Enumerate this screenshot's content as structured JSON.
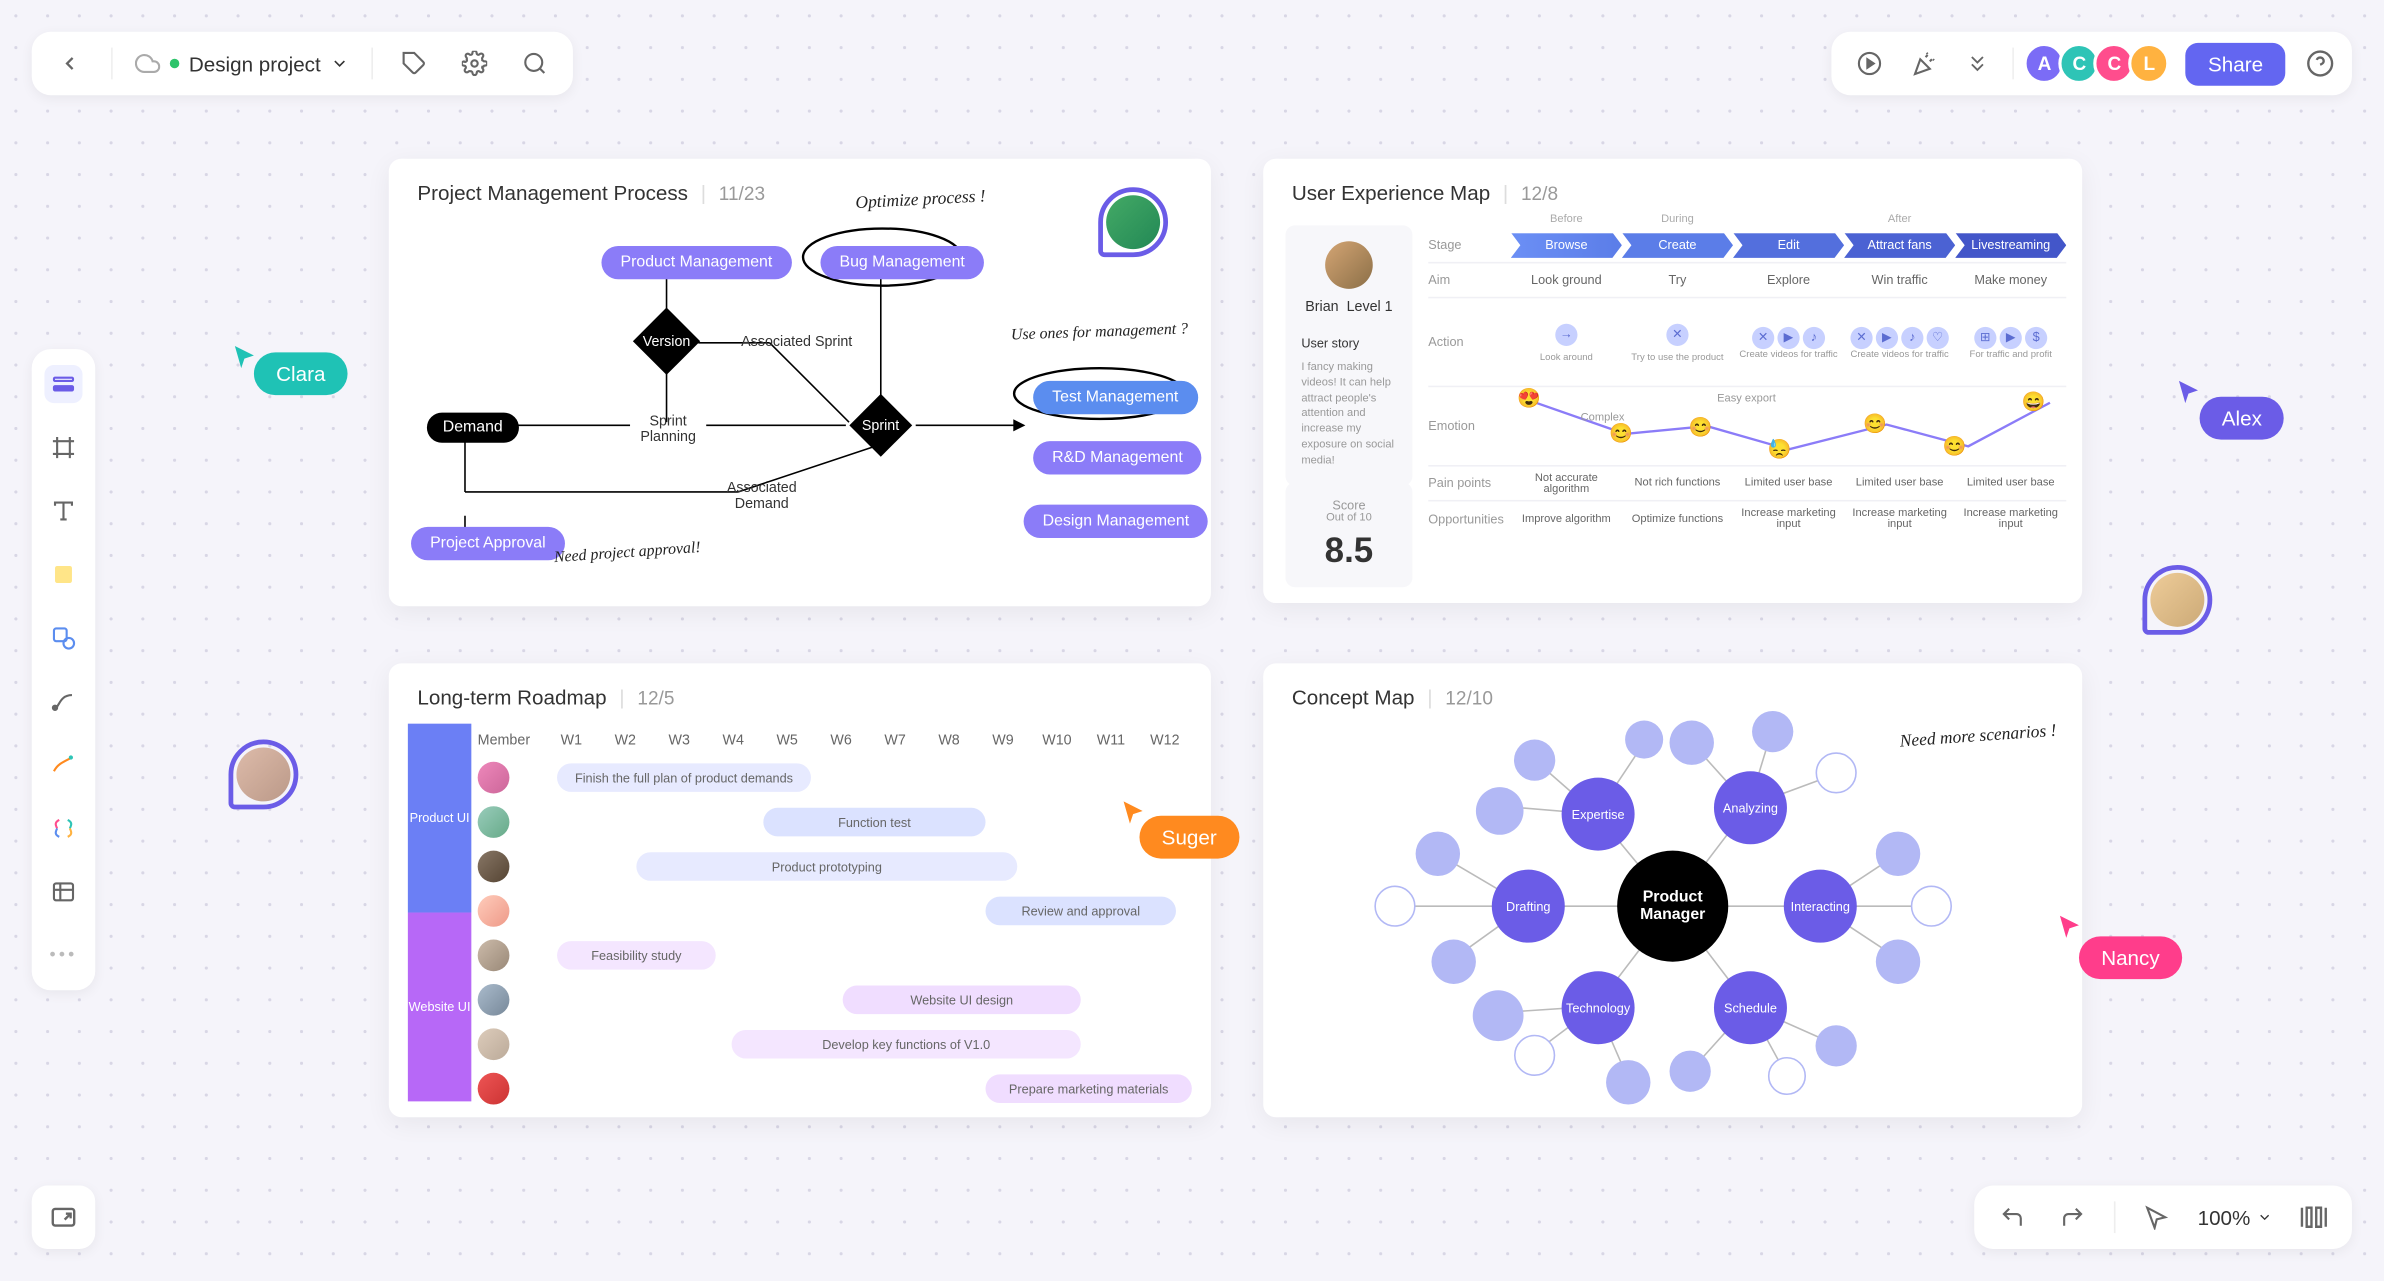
{
  "project": {
    "name": "Design project"
  },
  "topbar": {
    "share_label": "Share",
    "collaborators": [
      {
        "initial": "A",
        "color": "#7b6cf6"
      },
      {
        "initial": "C",
        "color": "#2ec4b6"
      },
      {
        "initial": "C",
        "color": "#ff4d8d"
      },
      {
        "initial": "L",
        "color": "#ffb240"
      }
    ]
  },
  "zoom": {
    "level": "100%"
  },
  "cursors": {
    "clara": {
      "label": "Clara",
      "color": "#1fc2b5"
    },
    "alex": {
      "label": "Alex",
      "color": "#6b5ce7"
    },
    "suger": {
      "label": "Suger",
      "color": "#ff8a1f"
    },
    "nancy": {
      "label": "Nancy",
      "color": "#ff3d8b"
    }
  },
  "card_process": {
    "title": "Project Management Process",
    "date": "11/23",
    "nodes": {
      "product_mgmt": "Product Management",
      "bug_mgmt": "Bug Management",
      "version": "Version",
      "demand": "Demand",
      "sprint": "Sprint",
      "test_mgmt": "Test Management",
      "rd_mgmt": "R&D Management",
      "design_mgmt": "Design Management",
      "project_approval": "Project Approval"
    },
    "labels": {
      "assoc_sprint": "Associated Sprint",
      "sprint_planning": "Sprint Planning",
      "assoc_demand": "Associated Demand"
    },
    "notes": {
      "optimize": "Optimize process !",
      "use_ones": "Use ones for management ?",
      "need_approval": "Need project approval!"
    }
  },
  "card_ux": {
    "title": "User Experience Map",
    "date": "12/8",
    "persona": {
      "name": "Brian",
      "level": "Level 1"
    },
    "user_story_label": "User story",
    "user_story": "I fancy making videos! It can help attract people's attention and increase my exposure on social media!",
    "score_label": "Score",
    "score_sub": "Out of 10",
    "score_value": "8.5",
    "phases_top": [
      "Before",
      "During",
      "After"
    ],
    "rows": {
      "stage": "Stage",
      "aim": "Aim",
      "action": "Action",
      "emotion": "Emotion",
      "pain": "Pain points",
      "opp": "Opportunities"
    },
    "stages": [
      "Browse",
      "Create",
      "Edit",
      "Attract fans",
      "Livestreaming"
    ],
    "aims": [
      "Look ground",
      "Try",
      "Explore",
      "Win traffic",
      "Make money"
    ],
    "action_labels": [
      "Look around",
      "Try to use the product",
      "Create videos for traffic",
      "Create videos for traffic",
      "For traffic and profit"
    ],
    "emotion_labels": [
      "Complex",
      "Easy export"
    ],
    "pains": [
      "Not accurate algorithm",
      "Not rich functions",
      "Limited user base",
      "Limited user base",
      "Limited user base"
    ],
    "opps": [
      "Improve algorithm",
      "Optimize functions",
      "Increase marketing input",
      "Increase marketing input",
      "Increase marketing input"
    ]
  },
  "card_roadmap": {
    "title": "Long-term Roadmap",
    "date": "12/5",
    "member_col": "Member",
    "weeks": [
      "W1",
      "W2",
      "W3",
      "W4",
      "W5",
      "W6",
      "W7",
      "W8",
      "W9",
      "W10",
      "W11",
      "W12"
    ],
    "groups": [
      {
        "label": "Product UI",
        "color": "#6b7ff5"
      },
      {
        "label": "Website UI",
        "color": "#b768f7"
      }
    ],
    "tasks": [
      {
        "label": "Finish the full plan of product demands",
        "color": "#e7eaff"
      },
      {
        "label": "Function test",
        "color": "#dbe2ff"
      },
      {
        "label": "Product prototyping",
        "color": "#e7eaff"
      },
      {
        "label": "Review and approval",
        "color": "#dbe2ff"
      },
      {
        "label": "Feasibility study",
        "color": "#f4e6ff"
      },
      {
        "label": "Website UI design",
        "color": "#f0ddff"
      },
      {
        "label": "Develop key functions of V1.0",
        "color": "#f4e6ff"
      },
      {
        "label": "Prepare marketing materials",
        "color": "#f0ddff"
      }
    ]
  },
  "card_concept": {
    "title": "Concept Map",
    "date": "12/10",
    "center": "Product Manager",
    "main_nodes": [
      "Expertise",
      "Analyzing",
      "Interacting",
      "Schedule",
      "Technology",
      "Drafting"
    ],
    "note": "Need more scenarios !"
  }
}
